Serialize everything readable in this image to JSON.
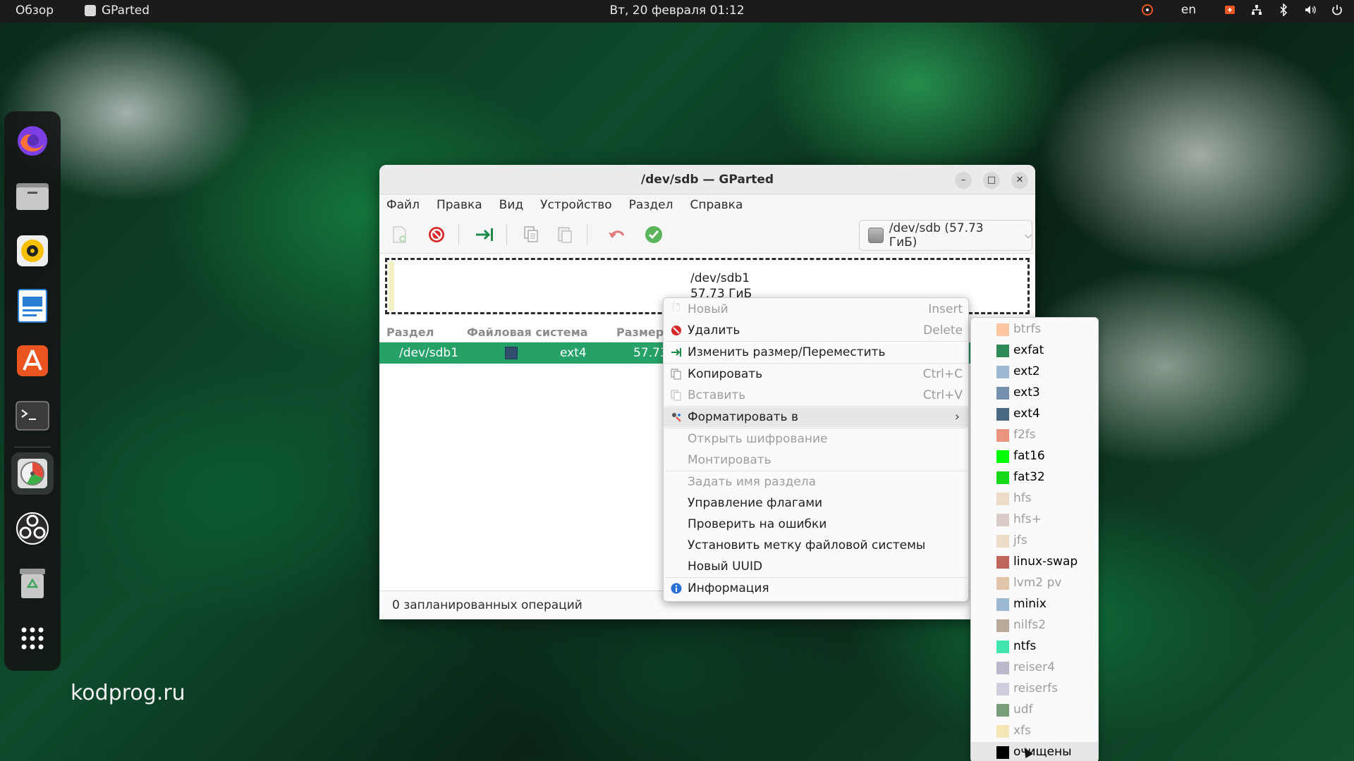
{
  "topbar": {
    "overview": "Обзор",
    "app_name": "GParted",
    "clock": "Вт, 20 февраля  01:12",
    "lang": "en",
    "icons": [
      "ubuntu-icon",
      "update-icon",
      "network-icon",
      "bluetooth-icon",
      "volume-icon",
      "power-icon"
    ]
  },
  "dock": {
    "apps": [
      "firefox-icon",
      "files-icon",
      "rhythmbox-icon",
      "writer-icon",
      "app-center-icon",
      "terminal-icon",
      "gparted-icon",
      "obs-icon",
      "trash-icon",
      "app-grid-icon"
    ]
  },
  "watermark": "kodprog.ru",
  "window": {
    "title": "/dev/sdb — GParted",
    "menu": [
      "Файл",
      "Правка",
      "Вид",
      "Устройство",
      "Раздел",
      "Справка"
    ],
    "device": "/dev/sdb (57.73 ГиБ)",
    "partmap": {
      "name": "/dev/sdb1",
      "size": "57.73 ГиБ"
    },
    "columns": [
      "Раздел",
      "Файловая система",
      "Размер"
    ],
    "row": {
      "partition": "/dev/sdb1",
      "fs": "ext4",
      "size": "57.73",
      "fs_color": "#314e6c"
    },
    "status": "0 запланированных операций"
  },
  "context_menu": {
    "items": [
      {
        "label": "Новый",
        "accel": "Insert",
        "disabled": true
      },
      {
        "label": "Удалить",
        "accel": "Delete"
      },
      {
        "label": "Изменить размер/Переместить"
      },
      {
        "label": "Копировать",
        "accel": "Ctrl+C"
      },
      {
        "label": "Вставить",
        "accel": "Ctrl+V",
        "disabled": true
      },
      {
        "label": "Форматировать в"
      },
      {
        "label": "Открыть шифрование",
        "disabled": true
      },
      {
        "label": "Монтировать",
        "disabled": true
      },
      {
        "label": "Задать имя раздела",
        "disabled": true
      },
      {
        "label": "Управление флагами"
      },
      {
        "label": "Проверить на ошибки"
      },
      {
        "label": "Установить метку файловой системы"
      },
      {
        "label": "Новый UUID"
      },
      {
        "label": "Информация"
      }
    ]
  },
  "format_submenu": {
    "items": [
      {
        "label": "btrfs",
        "color": "#ff9955",
        "disabled": true
      },
      {
        "label": "exfat",
        "color": "#2e8b57"
      },
      {
        "label": "ext2",
        "color": "#9db8d2"
      },
      {
        "label": "ext3",
        "color": "#7590ae"
      },
      {
        "label": "ext4",
        "color": "#4b6983"
      },
      {
        "label": "f2fs",
        "color": "#df421e",
        "disabled": true
      },
      {
        "label": "fat16",
        "color": "#00ff00"
      },
      {
        "label": "fat32",
        "color": "#18d918"
      },
      {
        "label": "hfs",
        "color": "#e0c39e",
        "disabled": true
      },
      {
        "label": "hfs+",
        "color": "#c0a39e",
        "disabled": true
      },
      {
        "label": "jfs",
        "color": "#e0c39e",
        "disabled": true
      },
      {
        "label": "linux-swap",
        "color": "#c1665a"
      },
      {
        "label": "lvm2 pv",
        "color": "#cc9966",
        "disabled": true
      },
      {
        "label": "minix",
        "color": "#9db8d2"
      },
      {
        "label": "nilfs2",
        "color": "#826647",
        "disabled": true
      },
      {
        "label": "ntfs",
        "color": "#42e5ac"
      },
      {
        "label": "reiser4",
        "color": "#887fa3",
        "disabled": true
      },
      {
        "label": "reiserfs",
        "color": "#ada7c8",
        "disabled": true
      },
      {
        "label": "udf",
        "color": "#105210",
        "disabled": true
      },
      {
        "label": "xfs",
        "color": "#eed680",
        "disabled": true
      },
      {
        "label": "очищены",
        "color": "#000000"
      }
    ]
  }
}
